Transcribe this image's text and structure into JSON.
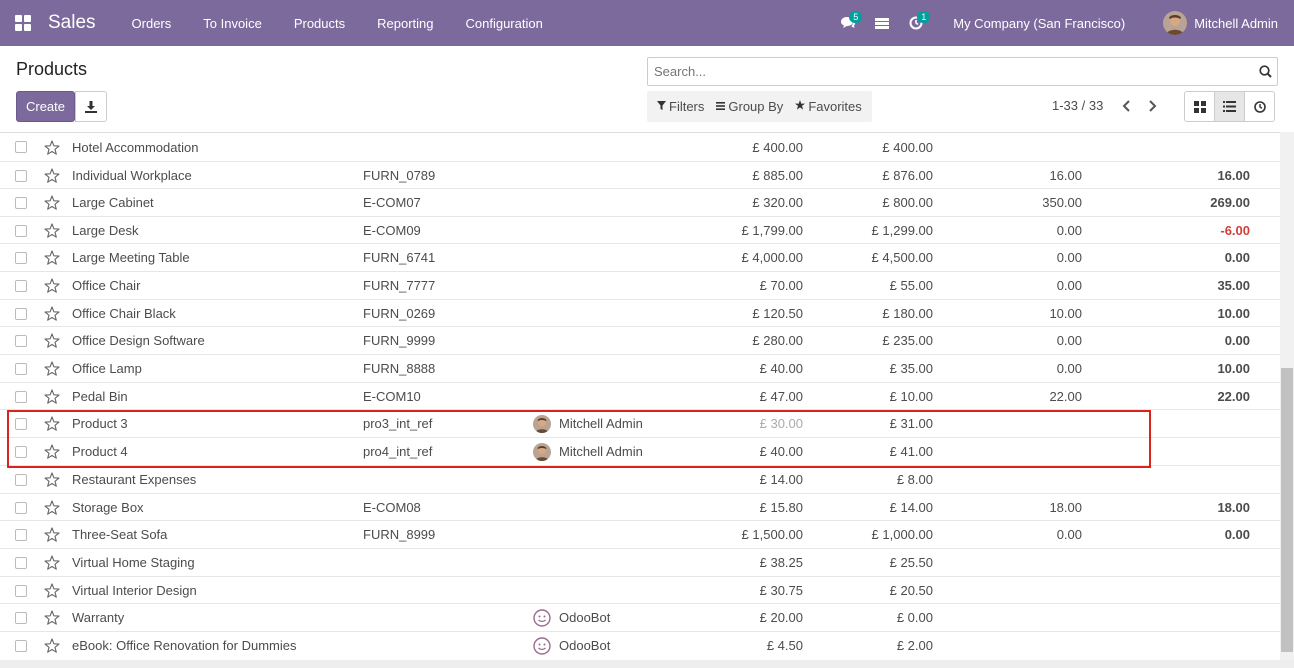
{
  "app": {
    "brand": "Sales",
    "menu": [
      "Orders",
      "To Invoice",
      "Products",
      "Reporting",
      "Configuration"
    ],
    "messages_badge": "5",
    "activity_badge": "1",
    "company": "My Company (San Francisco)",
    "user": "Mitchell Admin"
  },
  "control": {
    "title": "Products",
    "create_label": "Create",
    "search_placeholder": "Search...",
    "filters_label": "Filters",
    "groupby_label": "Group By",
    "favorites_label": "Favorites",
    "pager": "1-33 / 33"
  },
  "rows": [
    {
      "name": "Hotel Accommodation",
      "ref": "",
      "responsible": "",
      "avatar": "",
      "price": "£ 400.00",
      "cost": "£ 400.00",
      "onhand": "",
      "forecast": "",
      "neg": false,
      "price_muted": false
    },
    {
      "name": "Individual Workplace",
      "ref": "FURN_0789",
      "responsible": "",
      "avatar": "",
      "price": "£ 885.00",
      "cost": "£ 876.00",
      "onhand": "16.00",
      "forecast": "16.00",
      "neg": false,
      "price_muted": false
    },
    {
      "name": "Large Cabinet",
      "ref": "E-COM07",
      "responsible": "",
      "avatar": "",
      "price": "£ 320.00",
      "cost": "£ 800.00",
      "onhand": "350.00",
      "forecast": "269.00",
      "neg": false,
      "price_muted": false
    },
    {
      "name": "Large Desk",
      "ref": "E-COM09",
      "responsible": "",
      "avatar": "",
      "price": "£ 1,799.00",
      "cost": "£ 1,299.00",
      "onhand": "0.00",
      "forecast": "-6.00",
      "neg": true,
      "price_muted": false
    },
    {
      "name": "Large Meeting Table",
      "ref": "FURN_6741",
      "responsible": "",
      "avatar": "",
      "price": "£ 4,000.00",
      "cost": "£ 4,500.00",
      "onhand": "0.00",
      "forecast": "0.00",
      "neg": false,
      "price_muted": false
    },
    {
      "name": "Office Chair",
      "ref": "FURN_7777",
      "responsible": "",
      "avatar": "",
      "price": "£ 70.00",
      "cost": "£ 55.00",
      "onhand": "0.00",
      "forecast": "35.00",
      "neg": false,
      "price_muted": false
    },
    {
      "name": "Office Chair Black",
      "ref": "FURN_0269",
      "responsible": "",
      "avatar": "",
      "price": "£ 120.50",
      "cost": "£ 180.00",
      "onhand": "10.00",
      "forecast": "10.00",
      "neg": false,
      "price_muted": false
    },
    {
      "name": "Office Design Software",
      "ref": "FURN_9999",
      "responsible": "",
      "avatar": "",
      "price": "£ 280.00",
      "cost": "£ 235.00",
      "onhand": "0.00",
      "forecast": "0.00",
      "neg": false,
      "price_muted": false
    },
    {
      "name": "Office Lamp",
      "ref": "FURN_8888",
      "responsible": "",
      "avatar": "",
      "price": "£ 40.00",
      "cost": "£ 35.00",
      "onhand": "0.00",
      "forecast": "10.00",
      "neg": false,
      "price_muted": false
    },
    {
      "name": "Pedal Bin",
      "ref": "E-COM10",
      "responsible": "",
      "avatar": "",
      "price": "£ 47.00",
      "cost": "£ 10.00",
      "onhand": "22.00",
      "forecast": "22.00",
      "neg": false,
      "price_muted": false
    },
    {
      "name": "Product 3",
      "ref": "pro3_int_ref",
      "responsible": "Mitchell Admin",
      "avatar": "user",
      "price": "£ 30.00",
      "cost": "£ 31.00",
      "onhand": "",
      "forecast": "",
      "neg": false,
      "price_muted": true
    },
    {
      "name": "Product 4",
      "ref": "pro4_int_ref",
      "responsible": "Mitchell Admin",
      "avatar": "user",
      "price": "£ 40.00",
      "cost": "£ 41.00",
      "onhand": "",
      "forecast": "",
      "neg": false,
      "price_muted": false
    },
    {
      "name": "Restaurant Expenses",
      "ref": "",
      "responsible": "",
      "avatar": "",
      "price": "£ 14.00",
      "cost": "£ 8.00",
      "onhand": "",
      "forecast": "",
      "neg": false,
      "price_muted": false
    },
    {
      "name": "Storage Box",
      "ref": "E-COM08",
      "responsible": "",
      "avatar": "",
      "price": "£ 15.80",
      "cost": "£ 14.00",
      "onhand": "18.00",
      "forecast": "18.00",
      "neg": false,
      "price_muted": false
    },
    {
      "name": "Three-Seat Sofa",
      "ref": "FURN_8999",
      "responsible": "",
      "avatar": "",
      "price": "£ 1,500.00",
      "cost": "£ 1,000.00",
      "onhand": "0.00",
      "forecast": "0.00",
      "neg": false,
      "price_muted": false
    },
    {
      "name": "Virtual Home Staging",
      "ref": "",
      "responsible": "",
      "avatar": "",
      "price": "£ 38.25",
      "cost": "£ 25.50",
      "onhand": "",
      "forecast": "",
      "neg": false,
      "price_muted": false
    },
    {
      "name": "Virtual Interior Design",
      "ref": "",
      "responsible": "",
      "avatar": "",
      "price": "£ 30.75",
      "cost": "£ 20.50",
      "onhand": "",
      "forecast": "",
      "neg": false,
      "price_muted": false
    },
    {
      "name": "Warranty",
      "ref": "",
      "responsible": "OdooBot",
      "avatar": "bot",
      "price": "£ 20.00",
      "cost": "£ 0.00",
      "onhand": "",
      "forecast": "",
      "neg": false,
      "price_muted": false
    },
    {
      "name": "eBook: Office Renovation for Dummies",
      "ref": "",
      "responsible": "OdooBot",
      "avatar": "bot",
      "price": "£ 4.50",
      "cost": "£ 2.00",
      "onhand": "",
      "forecast": "",
      "neg": false,
      "price_muted": false
    }
  ],
  "colors": {
    "navbar": "#7c6a9c",
    "negative": "#d23f3a",
    "highlight": "#d9241c"
  }
}
